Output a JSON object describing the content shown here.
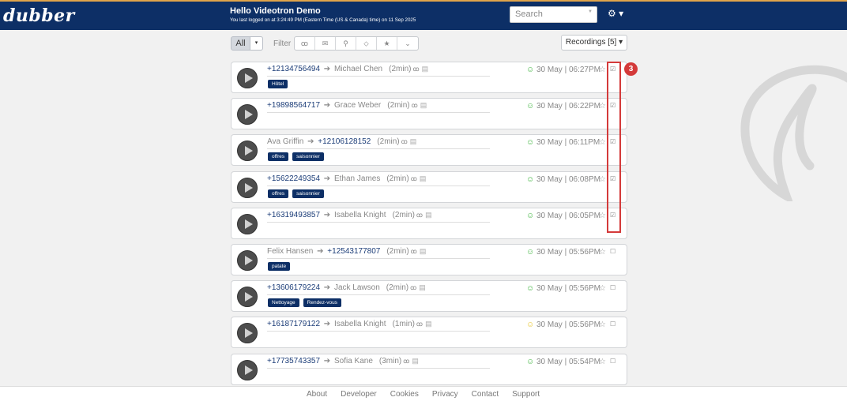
{
  "header": {
    "logo": "dubber",
    "greeting": "Hello Videotron Demo",
    "last_login": "You last logged on at 3:24:49 PM (Eastern Time (US & Canada) time) on 11 Sep 2025",
    "search_placeholder": "Search",
    "gear_icon": "⚙ ▾"
  },
  "toolbar": {
    "all_label": "All",
    "all_dropdown": "▾",
    "filter_label": "Filter",
    "filter_icons": [
      "voicemail-icon",
      "mail-icon",
      "map-pin-icon",
      "tag-icon",
      "star-icon",
      "chevron-icon"
    ],
    "filter_glyphs": [
      "ꝏ",
      "✉",
      "⚲",
      "⬦",
      "★",
      "⌄"
    ],
    "recordings_label": "Recordings [5] ▾"
  },
  "rows": [
    {
      "from": "+12134756494",
      "to": "Michael Chen",
      "from_blue": true,
      "duration": "(2min)",
      "tags": [
        "Hôtel"
      ],
      "mood": "good",
      "date": "30 May | 06:27PM",
      "checked": true
    },
    {
      "from": "+19898564717",
      "to": "Grace Weber",
      "from_blue": true,
      "duration": "(2min)",
      "tags": [],
      "mood": "good",
      "date": "30 May | 06:22PM",
      "checked": true
    },
    {
      "from": "Ava Griffin",
      "to": "+12106128152",
      "from_blue": false,
      "duration": "(2min)",
      "tags": [
        "offres",
        "saisonnier"
      ],
      "mood": "good",
      "date": "30 May | 06:11PM",
      "checked": true
    },
    {
      "from": "+15622249354",
      "to": "Ethan James",
      "from_blue": true,
      "duration": "(2min)",
      "tags": [
        "offres",
        "saisonnier"
      ],
      "mood": "good",
      "date": "30 May | 06:08PM",
      "checked": true
    },
    {
      "from": "+16319493857",
      "to": "Isabella Knight",
      "from_blue": true,
      "duration": "(2min)",
      "tags": [],
      "mood": "good",
      "date": "30 May | 06:05PM",
      "checked": true
    },
    {
      "from": "Felix Hansen",
      "to": "+12543177807",
      "from_blue": false,
      "duration": "(2min)",
      "tags": [
        "patate"
      ],
      "mood": "good",
      "date": "30 May | 05:56PM",
      "checked": false
    },
    {
      "from": "+13606179224",
      "to": "Jack Lawson",
      "from_blue": true,
      "duration": "(2min)",
      "tags": [
        "Nettoyage",
        "Rendez-vous"
      ],
      "mood": "good",
      "date": "30 May | 05:56PM",
      "checked": false
    },
    {
      "from": "+16187179122",
      "to": "Isabella Knight",
      "from_blue": true,
      "duration": "(1min)",
      "tags": [],
      "mood": "neutral",
      "date": "30 May | 05:56PM",
      "checked": false
    },
    {
      "from": "+17735743357",
      "to": "Sofia Kane",
      "from_blue": true,
      "duration": "(3min)",
      "tags": [],
      "mood": "good",
      "date": "30 May | 05:54PM",
      "checked": false
    }
  ],
  "annotation": {
    "badge": "3"
  },
  "colors": {
    "brand": "#0d2f66",
    "accent": "#d43a3a",
    "positive": "#3db43d",
    "neutral": "#e8c52a"
  },
  "footer": {
    "links": [
      "About",
      "Developer",
      "Cookies",
      "Privacy",
      "Contact",
      "Support"
    ]
  }
}
